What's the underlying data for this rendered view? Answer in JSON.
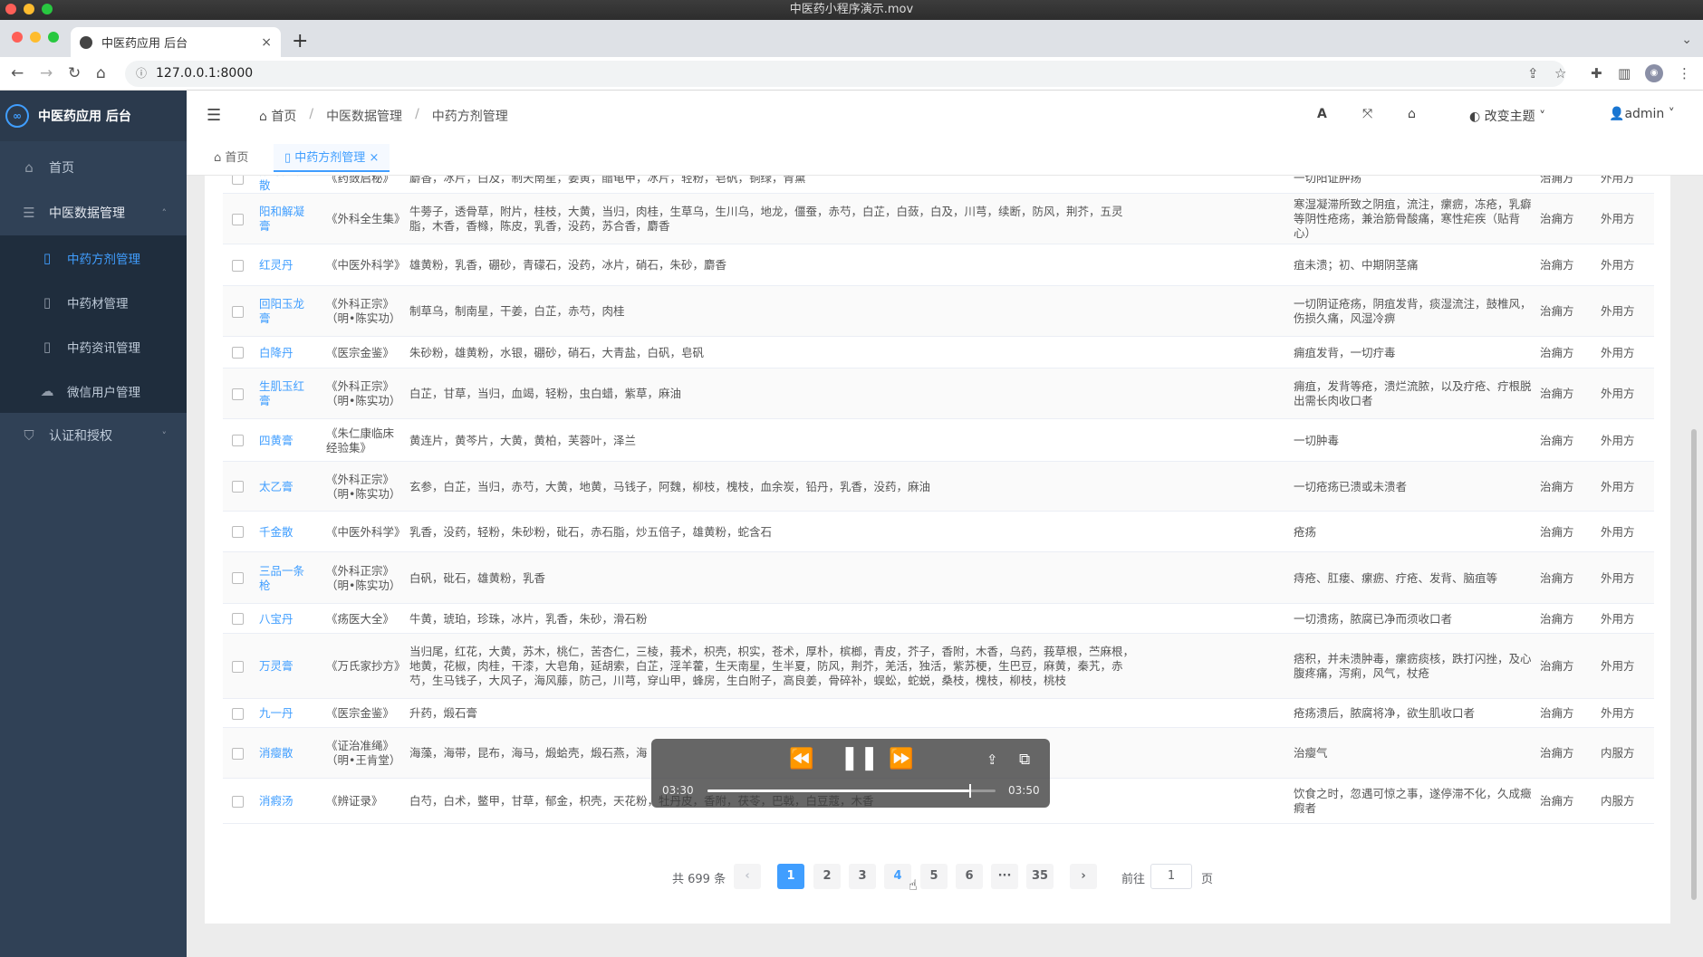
{
  "window": {
    "title": "中医药小程序演示.mov"
  },
  "browser": {
    "tab_title": "中医药应用 后台",
    "tab_close": "×",
    "new_tab": "+",
    "url": "127.0.0.1:8000"
  },
  "sidebar": {
    "app_name": "中医药应用 后台",
    "logo_mark": "∞",
    "home": "首页",
    "group_data": "中医数据管理",
    "items": [
      "中药方剂管理",
      "中药材管理",
      "中药资讯管理",
      "微信用户管理"
    ],
    "group_auth": "认证和授权"
  },
  "header": {
    "breadcrumb": [
      "首页",
      "中医数据管理",
      "中药方剂管理"
    ],
    "font_icon_label": "A",
    "theme": "改变主题",
    "user": "admin"
  },
  "tags": {
    "home": "首页",
    "current": "中药方剂管理",
    "close": "×"
  },
  "table": {
    "rows": [
      {
        "name": "阳毒内消散",
        "source": "《药蔹启秘》",
        "ingredients": "麝香，冰片，白及，制天南星，姜黄，醋龟甲，冰片，轻粉，皂矾，铜绿，青黛",
        "usage": "一切阳证肿疡",
        "category": "治痈方",
        "type": "外用方"
      },
      {
        "name": "阳和解凝膏",
        "source": "《外科全生集》",
        "ingredients": "牛蒡子，透骨草，附片，桂枝，大黄，当归，肉桂，生草乌，生川乌，地龙，僵蚕，赤芍，白芷，白蔹，白及，川芎，续断，防风，荆芥，五灵脂，木香，香橼，陈皮，乳香，没药，苏合香，麝香",
        "usage": "寒湿凝滞所致之阴疽，流注，瘰疬，冻疮，乳癖等阴性疮疡，兼治筋骨酸痛，寒性疟疾（贴背心）",
        "category": "治痈方",
        "type": "外用方"
      },
      {
        "name": "红灵丹",
        "source": "《中医外科学》",
        "ingredients": "雄黄粉，乳香，硼砂，青礞石，没药，冰片，硝石，朱砂，麝香",
        "usage": "疽未溃；初、中期阴茎痛",
        "category": "治痈方",
        "type": "外用方"
      },
      {
        "name": "回阳玉龙膏",
        "source": "《外科正宗》（明•陈实功）",
        "ingredients": "制草乌，制南星，干姜，白芷，赤芍，肉桂",
        "usage": "一切阴证疮疡，阴疽发背，痰湿流注，鼓椎风，伤损久痛，风湿冷痹",
        "category": "治痈方",
        "type": "外用方"
      },
      {
        "name": "白降丹",
        "source": "《医宗金鉴》",
        "ingredients": "朱砂粉，雄黄粉，水银，硼砂，硝石，大青盐，白矾，皂矾",
        "usage": "痈疽发背，一切疔毒",
        "category": "治痈方",
        "type": "外用方"
      },
      {
        "name": "生肌玉红膏",
        "source": "《外科正宗》（明•陈实功）",
        "ingredients": "白芷，甘草，当归，血竭，轻粉，虫白蜡，紫草，麻油",
        "usage": "痈疽，发背等疮，溃烂流脓，以及疔疮、疔根脱出需长肉收口者",
        "category": "治痈方",
        "type": "外用方"
      },
      {
        "name": "四黄膏",
        "source": "《朱仁康临床经验集》",
        "ingredients": "黄连片，黄芩片，大黄，黄柏，芙蓉叶，泽兰",
        "usage": "一切肿毒",
        "category": "治痈方",
        "type": "外用方"
      },
      {
        "name": "太乙膏",
        "source": "《外科正宗》（明•陈实功）",
        "ingredients": "玄参，白芷，当归，赤芍，大黄，地黄，马钱子，阿魏，柳枝，槐枝，血余炭，铅丹，乳香，没药，麻油",
        "usage": "一切疮疡已溃或未溃者",
        "category": "治痈方",
        "type": "外用方"
      },
      {
        "name": "千金散",
        "source": "《中医外科学》",
        "ingredients": "乳香，没药，轻粉，朱砂粉，砒石，赤石脂，炒五倍子，雄黄粉，蛇含石",
        "usage": "疮疡",
        "category": "治痈方",
        "type": "外用方"
      },
      {
        "name": "三品一条枪",
        "source": "《外科正宗》（明•陈实功）",
        "ingredients": "白矾，砒石，雄黄粉，乳香",
        "usage": "痔疮、肛瘘、瘰疬、疔疮、发背、脑疽等",
        "category": "治痈方",
        "type": "外用方"
      },
      {
        "name": "八宝丹",
        "source": "《疡医大全》",
        "ingredients": "牛黄，琥珀，珍珠，冰片，乳香，朱砂，滑石粉",
        "usage": "一切溃疡，脓腐已净而须收口者",
        "category": "治痈方",
        "type": "外用方"
      },
      {
        "name": "万灵膏",
        "source": "《万氏家抄方》",
        "ingredients": "当归尾，红花，大黄，苏木，桃仁，苦杏仁，三棱，莪术，枳壳，枳实，苍术，厚朴，槟榔，青皮，芥子，香附，木香，乌药，莪草根，苎麻根，地黄，花椒，肉桂，干漆，大皂角，延胡索，白芷，淫羊藿，生天南星，生半夏，防风，荆芥，羌活，独活，紫苏梗，生巴豆，麻黄，秦艽，赤芍，生马钱子，大风子，海风藤，防己，川芎，穿山甲，蜂房，生白附子，高良姜，骨碎补，蜈蚣，蛇蜕，桑枝，槐枝，柳枝，桃枝",
        "usage": "痞积，并未溃肿毒，瘰疬痰核，跌打闪挫，及心腹疼痛，泻痢，风气，杖疮",
        "category": "治痈方",
        "type": "外用方"
      },
      {
        "name": "九一丹",
        "source": "《医宗金鉴》",
        "ingredients": "升药，煅石膏",
        "usage": "疮疡溃后，脓腐将净，欲生肌收口者",
        "category": "治痈方",
        "type": "外用方"
      },
      {
        "name": "消瘿散",
        "source": "《证治准绳》（明•王肯堂）",
        "ingredients": "海藻，海带，昆布，海马，煅蛤壳，煅石燕，海",
        "usage": "治瘿气",
        "category": "治痈方",
        "type": "内服方"
      },
      {
        "name": "消瘕汤",
        "source": "《辨证录》",
        "ingredients": "白芍，白术，鳖甲，甘草，郁金，枳壳，天花粉，牡丹皮，香附，茯苓，巴戟，白豆蔻，木香",
        "usage": "饮食之时，忽遇可惊之事，遂停滞不化，久成癥瘕者",
        "category": "治痈方",
        "type": "内服方"
      }
    ]
  },
  "pagination": {
    "total": "共 699 条",
    "prev": "‹",
    "next": "›",
    "pages": [
      "1",
      "2",
      "3",
      "4",
      "5",
      "6",
      "···",
      "35"
    ],
    "current_page": "1",
    "goto_prefix": "前往",
    "goto_value": "1",
    "goto_suffix": "页"
  },
  "video": {
    "elapsed": "03:30",
    "remaining": "03:50",
    "progress": 0.91
  },
  "colors": {
    "accent": "#409eff",
    "sidebar_bg": "#304156"
  }
}
